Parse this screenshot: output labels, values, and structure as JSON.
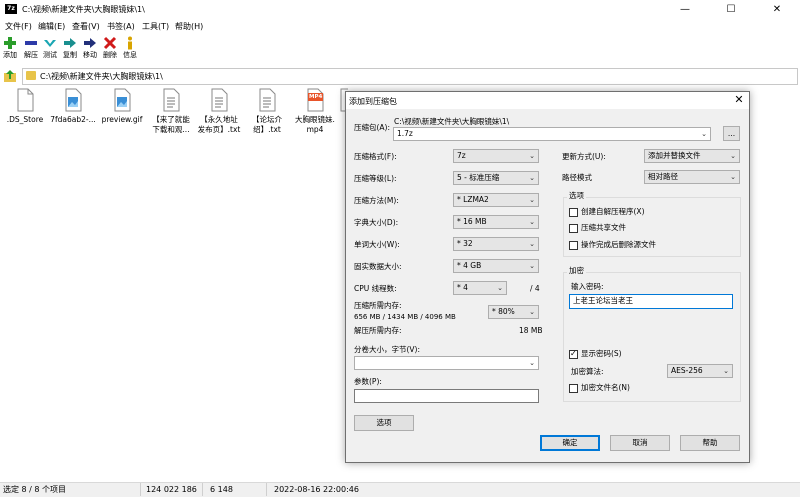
{
  "window": {
    "title": "C:\\视频\\新建文件夹\\大胸眼镜妹\\1\\",
    "app_icon_text": "7z",
    "minimize": "—",
    "maximize": "☐",
    "close": "✕"
  },
  "menu": [
    "文件(F)",
    "编辑(E)",
    "查看(V)",
    "书签(A)",
    "工具(T)",
    "帮助(H)"
  ],
  "toolbar": [
    "添加",
    "解压",
    "测试",
    "复制",
    "移动",
    "删除",
    "信息"
  ],
  "address": {
    "path": "C:\\视频\\新建文件夹\\大胸眼镜妹\\1\\"
  },
  "files": [
    {
      "name": ".DS_Store",
      "kind": "doc"
    },
    {
      "name": "7fda6ab2-...",
      "kind": "image"
    },
    {
      "name": "preview.gif",
      "kind": "image"
    },
    {
      "name": "【来了就能\n下载和观...",
      "kind": "doc"
    },
    {
      "name": "【永久地址\n发布页】.txt",
      "kind": "doc"
    },
    {
      "name": "【论坛介\n绍】.txt",
      "kind": "doc"
    },
    {
      "name": "大胸眼镜妹.\nmp4",
      "kind": "mp4",
      "badge": "MP4"
    },
    {
      "name": "",
      "kind": "doc"
    }
  ],
  "status": {
    "selected": "选定 8 / 8 个项目",
    "size": "124 022 186",
    "packed": "6 148",
    "modified": "2022-08-16 22:00:46"
  },
  "dialog": {
    "title": "添加到压缩包",
    "close": "✕",
    "archive_label": "压缩包(A):",
    "archive_path": "C:\\视频\\新建文件夹\\大胸眼镜妹\\1\\",
    "archive_name": "1.7z",
    "browse": "...",
    "format_label": "压缩格式(F):",
    "format_value": "7z",
    "level_label": "压缩等级(L):",
    "level_value": "5 - 标准压缩",
    "method_label": "压缩方法(M):",
    "method_value": "* LZMA2",
    "dict_label": "字典大小(D):",
    "dict_value": "* 16 MB",
    "word_label": "单词大小(W):",
    "word_value": "* 32",
    "solid_label": "固实数据大小:",
    "solid_value": "* 4 GB",
    "cpu_label": "CPU 线程数:",
    "cpu_value": "* 4",
    "cpu_total": "/ 4",
    "mem_comp_label": "压缩所需内存:",
    "mem_comp_value": "656 MB / 1434 MB / 4096 MB",
    "mem_percent": "* 80%",
    "mem_decomp_label": "解压所需内存:",
    "mem_decomp_value": "18 MB",
    "split_label": "分卷大小，字节(V):",
    "params_label": "参数(P):",
    "options_button": "选项",
    "update_label": "更新方式(U):",
    "update_value": "添加并替换文件",
    "path_mode_label": "路径模式",
    "path_mode_value": "相对路径",
    "options_group": "选项",
    "opt_sfx": "创建自解压程序(X)",
    "opt_shared": "压缩共享文件",
    "opt_delete": "操作完成后删除源文件",
    "enc_group": "加密",
    "password_label": "输入密码:",
    "password_value": "上老王论坛当老王",
    "show_password": "显示密码(S)",
    "enc_method_label": "加密算法:",
    "enc_method_value": "AES-256",
    "enc_filenames": "加密文件名(N)",
    "ok": "确定",
    "cancel": "取消",
    "help": "帮助"
  },
  "colors": {
    "accent": "#0078d7",
    "add": "#2a9d2a",
    "extract": "#2d3aa8",
    "test": "#1aa6b3",
    "delete": "#d01a1a",
    "info": "#d8a400"
  }
}
